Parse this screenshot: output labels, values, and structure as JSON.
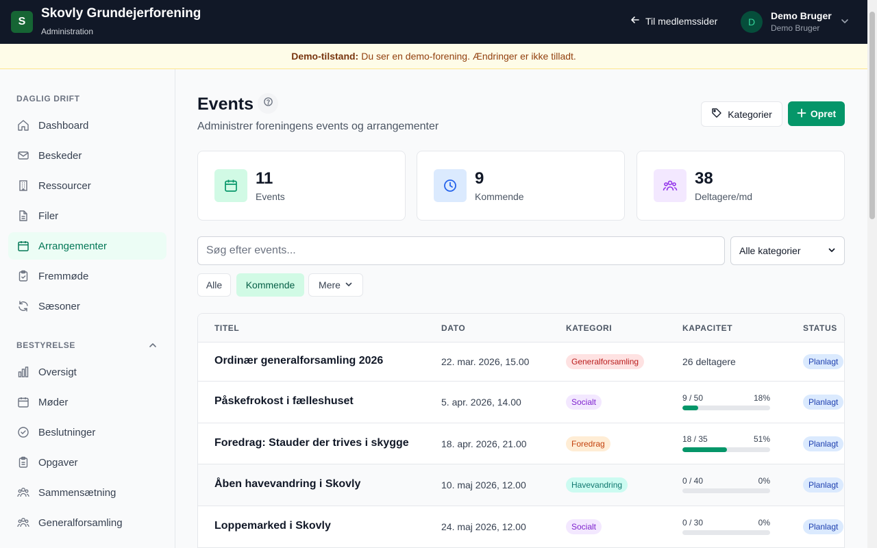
{
  "header": {
    "logo_letter": "S",
    "title": "Skovly Grundejerforening",
    "subtitle": "Administration",
    "member_link": "Til medlemssider",
    "user_initial": "D",
    "user_name": "Demo Bruger",
    "user_sub": "Demo Bruger"
  },
  "banner": {
    "label": "Demo-tilstand:",
    "text": "Du ser en demo-forening. Ændringer er ikke tilladt."
  },
  "sidebar": {
    "section1": "DAGLIG DRIFT",
    "daily": [
      {
        "label": "Dashboard",
        "icon": "home-icon"
      },
      {
        "label": "Beskeder",
        "icon": "mail-icon"
      },
      {
        "label": "Ressourcer",
        "icon": "building-icon"
      },
      {
        "label": "Filer",
        "icon": "file-icon"
      },
      {
        "label": "Arrangementer",
        "icon": "calendar-icon",
        "active": true
      },
      {
        "label": "Fremmøde",
        "icon": "clipboard-check-icon"
      },
      {
        "label": "Sæsoner",
        "icon": "refresh-icon"
      }
    ],
    "section2": "BESTYRELSE",
    "board": [
      {
        "label": "Oversigt",
        "icon": "bar-chart-icon"
      },
      {
        "label": "Møder",
        "icon": "calendar-icon"
      },
      {
        "label": "Beslutninger",
        "icon": "check-circle-icon"
      },
      {
        "label": "Opgaver",
        "icon": "clipboard-icon"
      },
      {
        "label": "Sammensætning",
        "icon": "users-icon"
      },
      {
        "label": "Generalforsamling",
        "icon": "users-icon"
      }
    ]
  },
  "main": {
    "title": "Events",
    "subtitle": "Administrer foreningens events og arrangementer",
    "btn_categories": "Kategorier",
    "btn_create": "Opret",
    "stats": [
      {
        "value": "11",
        "label": "Events"
      },
      {
        "value": "9",
        "label": "Kommende"
      },
      {
        "value": "38",
        "label": "Deltagere/md"
      }
    ],
    "search_placeholder": "Søg efter events...",
    "category_select": "Alle kategorier",
    "filters": [
      "Alle",
      "Kommende",
      "Mere"
    ]
  },
  "table": {
    "columns": [
      "TITEL",
      "DATO",
      "KATEGORI",
      "KAPACITET",
      "STATUS"
    ],
    "rows": [
      {
        "title": "Ordinær generalforsamling 2026",
        "date": "22. mar. 2026, 15.00",
        "category": "Generalforsamling",
        "capacity_text": "26 deltagere",
        "status": "Planlagt"
      },
      {
        "title": "Påskefrokost i fælleshuset",
        "date": "5. apr. 2026, 14.00",
        "category": "Socialt",
        "cap": "9 / 50",
        "pct": "18%",
        "fill": 0.18,
        "status": "Planlagt"
      },
      {
        "title": "Foredrag: Stauder der trives i skygge",
        "date": "18. apr. 2026, 21.00",
        "category": "Foredrag",
        "cap": "18 / 35",
        "pct": "51%",
        "fill": 0.51,
        "status": "Planlagt"
      },
      {
        "title": "Åben havevandring i Skovly",
        "date": "10. maj 2026, 12.00",
        "category": "Havevandring",
        "cap": "0 / 40",
        "pct": "0%",
        "fill": 0,
        "status": "Planlagt"
      },
      {
        "title": "Loppemarked i Skovly",
        "date": "24. maj 2026, 12.00",
        "category": "Socialt",
        "cap": "0 / 30",
        "pct": "0%",
        "fill": 0,
        "status": "Planlagt"
      }
    ]
  },
  "colors": {
    "accent": "#059669",
    "badge_generalforsamling_bg": "#fee2e2",
    "badge_socialt_bg": "#f3e8ff",
    "badge_foredrag_bg": "#ffedd5",
    "badge_havevandring_bg": "#ccfbf1",
    "status_bg": "#dbeafe"
  }
}
